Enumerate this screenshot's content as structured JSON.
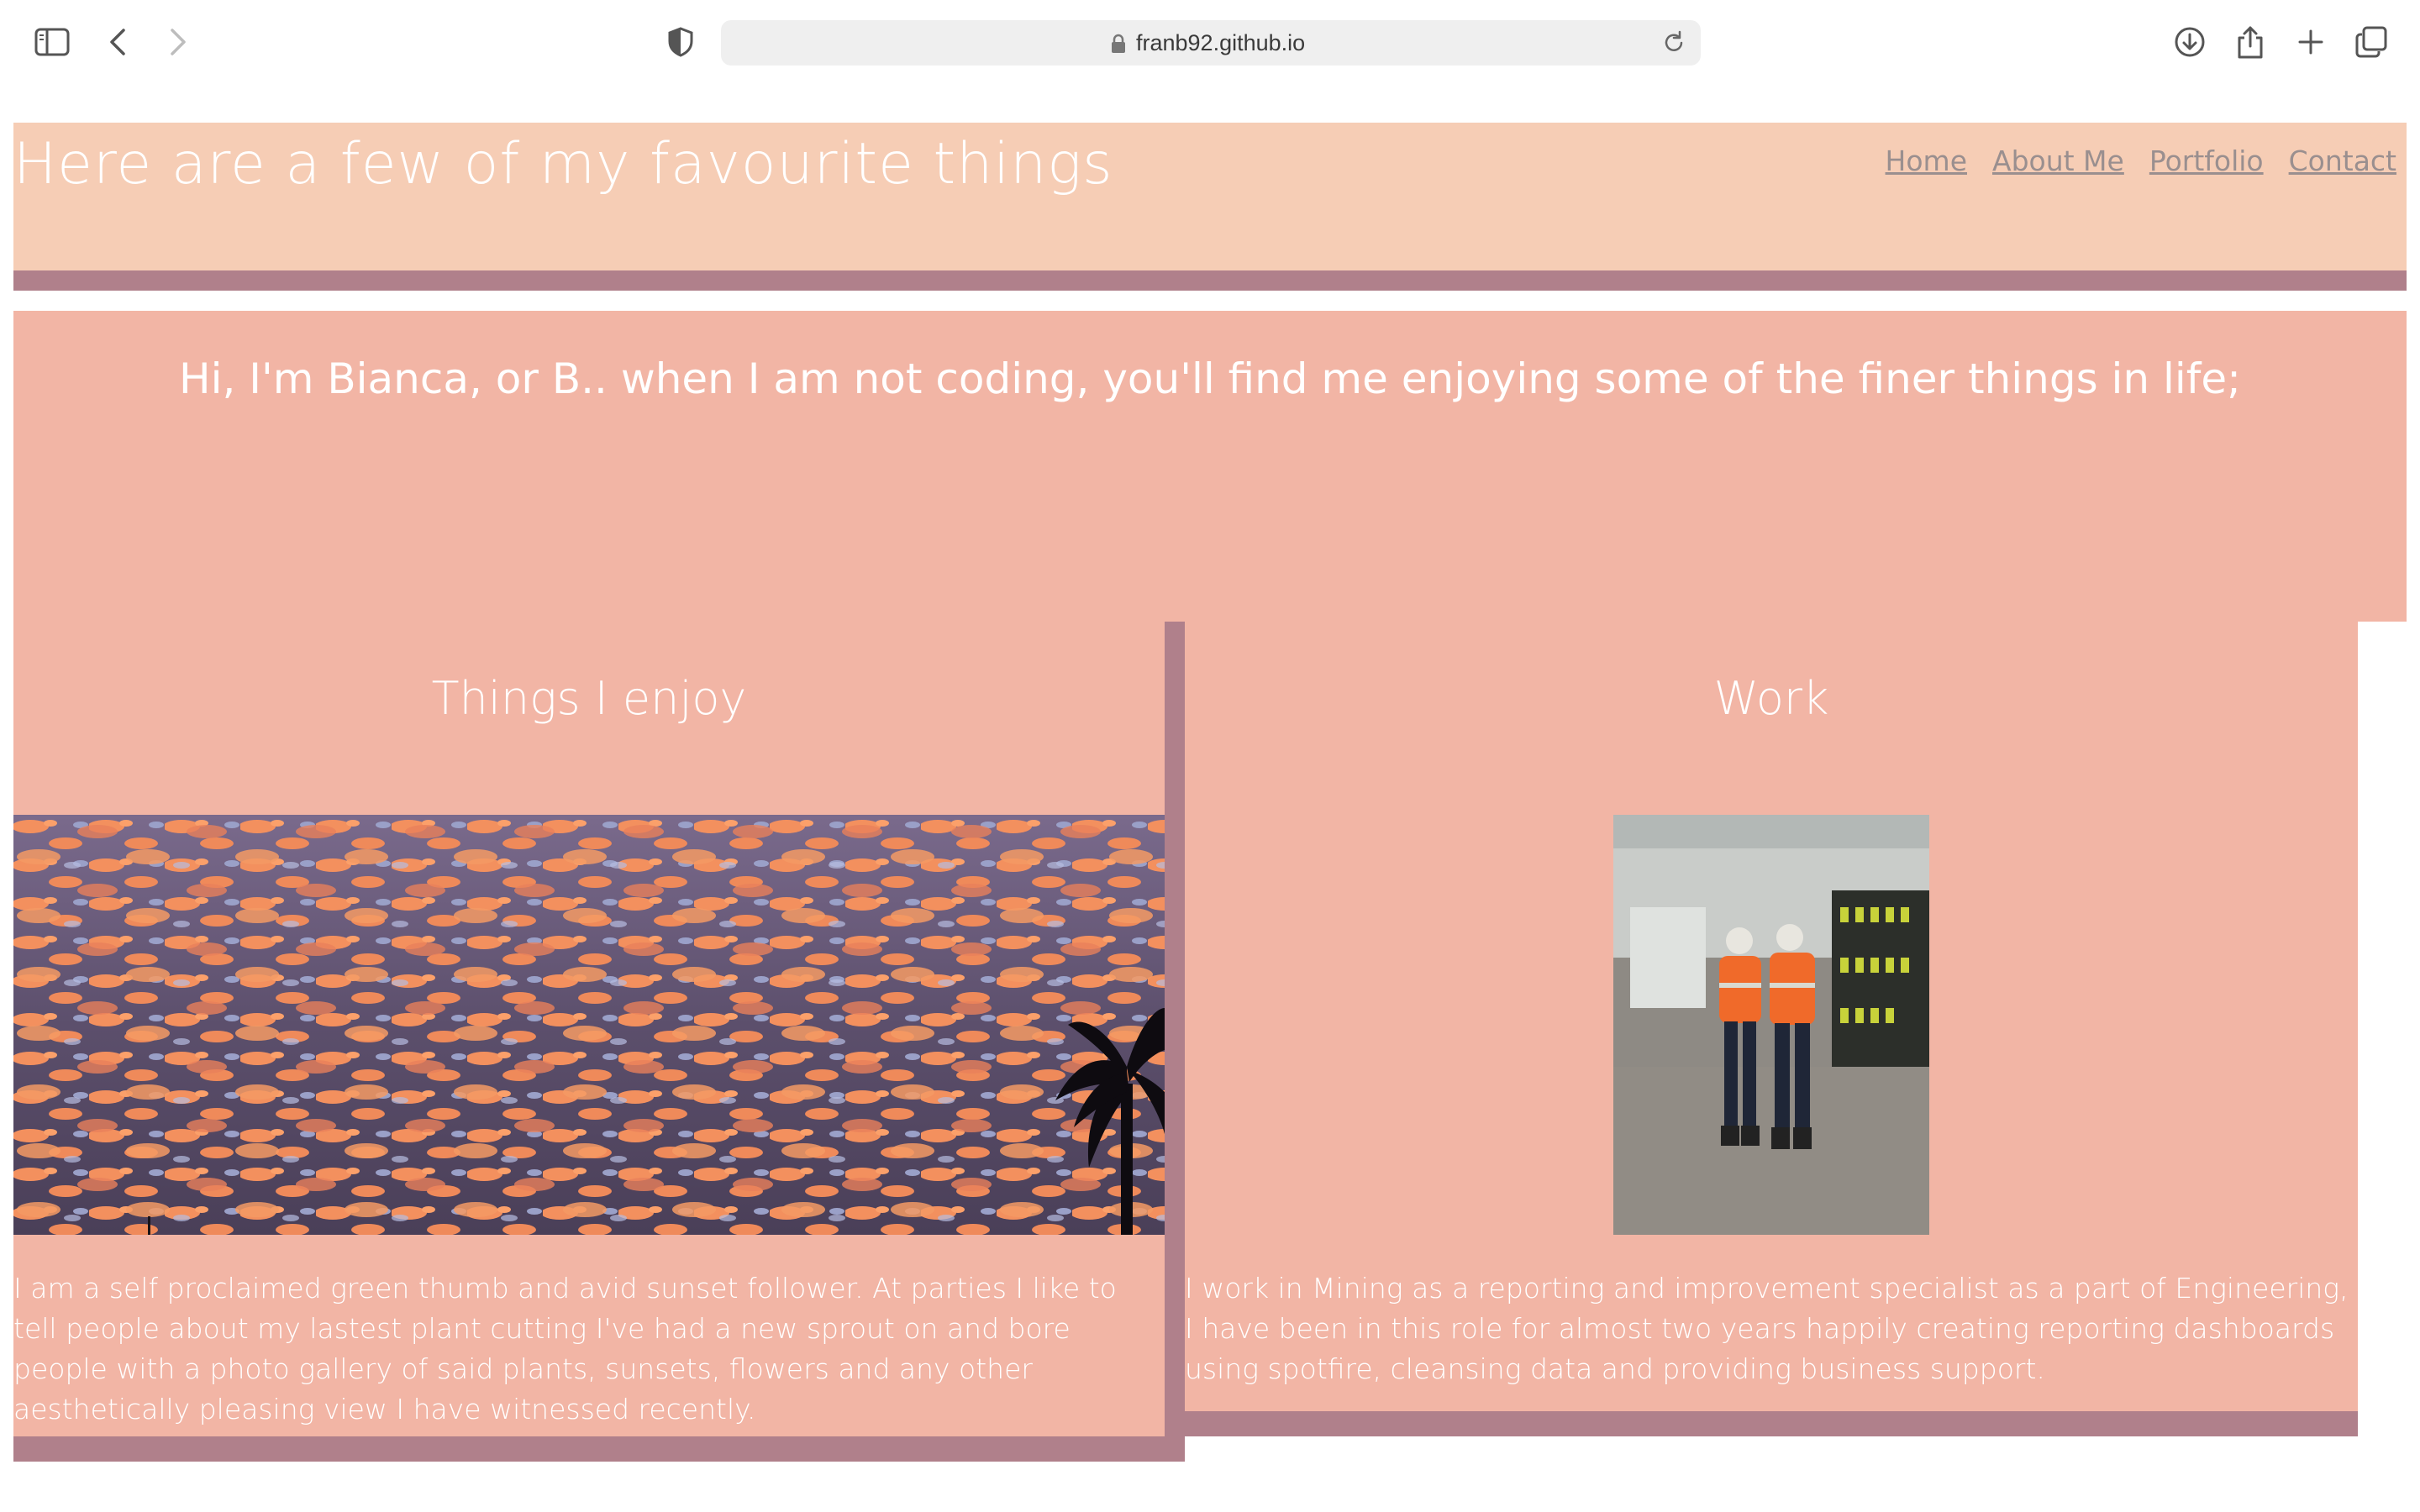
{
  "browser": {
    "url": "franb92.github.io",
    "icons": {
      "sidebar": "sidebar-icon",
      "back": "chevron-left-icon",
      "forward": "chevron-right-icon",
      "shield": "shield-icon",
      "lock": "lock-icon",
      "reload": "reload-icon",
      "download": "download-icon",
      "share": "share-icon",
      "new_tab": "plus-icon",
      "tabs": "tab-overview-icon"
    }
  },
  "header": {
    "title": "Here are a few of my favourite things",
    "nav": [
      "Home",
      "About Me",
      "Portfolio",
      "Contact"
    ]
  },
  "intro": {
    "text": "Hi, I'm Bianca, or B.. when I am not coding, you'll find me enjoying some of the finer things in life;"
  },
  "sections": [
    {
      "heading": "Things I enjoy",
      "body": "I am a self proclaimed green thumb and avid sunset follower. At parties I like to tell people about my lastest plant cutting I've had a new sprout on and bore people with a photo gallery of said plants, sunsets, flowers and any other aesthetically pleasing view I have witnessed recently."
    },
    {
      "heading": "Work",
      "body": "I work in Mining as a reporting and improvement specialist as a part of Engineering, I have been in this role for almost two years happily creating reporting dashboards using spotfire, cleansing data and providing business support."
    }
  ],
  "colors": {
    "header_bg": "#f6cdb5",
    "body_bg": "#f2b5a5",
    "accent_border": "#b0808b",
    "text": "#ffffff",
    "nav_link": "#9a8f8f"
  }
}
